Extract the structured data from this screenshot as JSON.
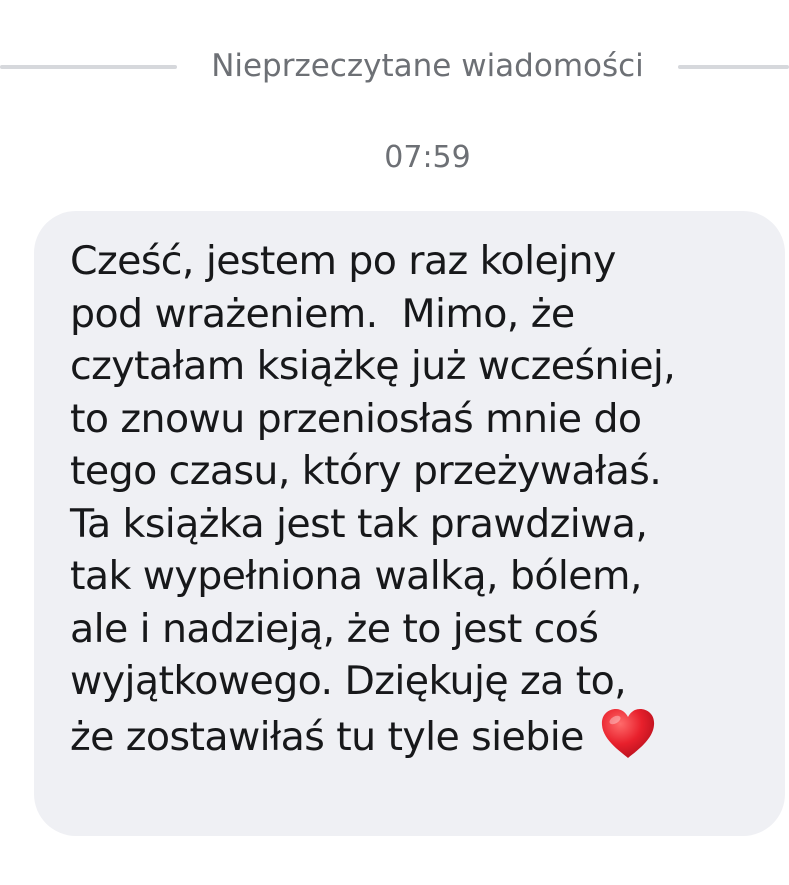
{
  "divider": {
    "label": "Nieprzeczytane wiadomości"
  },
  "timestamp": "07:59",
  "message": {
    "lines": [
      "Cześć, jestem po raz kolejny",
      "pod wrażeniem.  Mimo, że",
      "czytałam książkę już wcześniej,",
      "to znowu przeniosłaś mnie do",
      "tego czasu, który przeżywałaś.",
      "Ta książka jest tak prawdziwa,",
      "tak wypełniona walką, bólem,",
      "ale i nadzieją, że to jest coś",
      "wyjątkowego. Dziękuję za to,",
      "że zostawiłaś tu tyle siebie"
    ],
    "emoji": "red-heart",
    "bubble_color": "#eff0f4",
    "text_color": "#17181a"
  },
  "colors": {
    "divider_line": "#d6d8dc",
    "secondary_text": "#6d7075",
    "heart": "#e0242e"
  }
}
